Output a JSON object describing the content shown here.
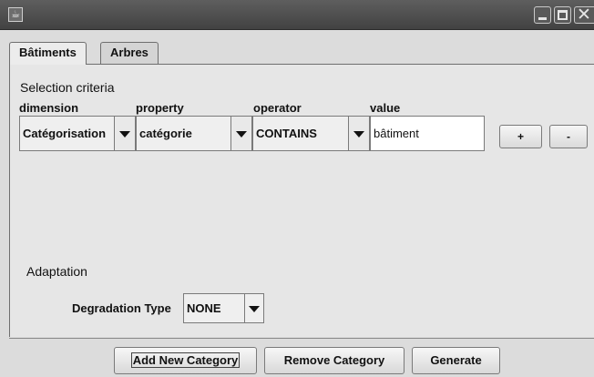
{
  "window": {
    "app_icon": "java-icon",
    "controls": [
      "minimize-icon",
      "maximize-icon",
      "close-icon"
    ]
  },
  "tabs": [
    {
      "label": "Bâtiments",
      "active": true
    },
    {
      "label": "Arbres",
      "active": false
    }
  ],
  "selection": {
    "title": "Selection criteria",
    "columns": {
      "dimension": "dimension",
      "property": "property",
      "operator": "operator",
      "value": "value"
    },
    "row": {
      "dimension": "Catégorisation",
      "property": "catégorie",
      "operator": "CONTAINS",
      "value": "bâtiment"
    },
    "add_label": "+",
    "remove_label": "-"
  },
  "adaptation": {
    "title": "Adaptation",
    "degradation_label": "Degradation Type",
    "degradation_value": "NONE"
  },
  "actions": {
    "add_category": "Add New Category",
    "remove_category": "Remove Category",
    "generate": "Generate"
  },
  "colors": {
    "titlebar": "#4a4a4a",
    "panel": "#e6e6e6",
    "field_bg": "#ffffff"
  }
}
